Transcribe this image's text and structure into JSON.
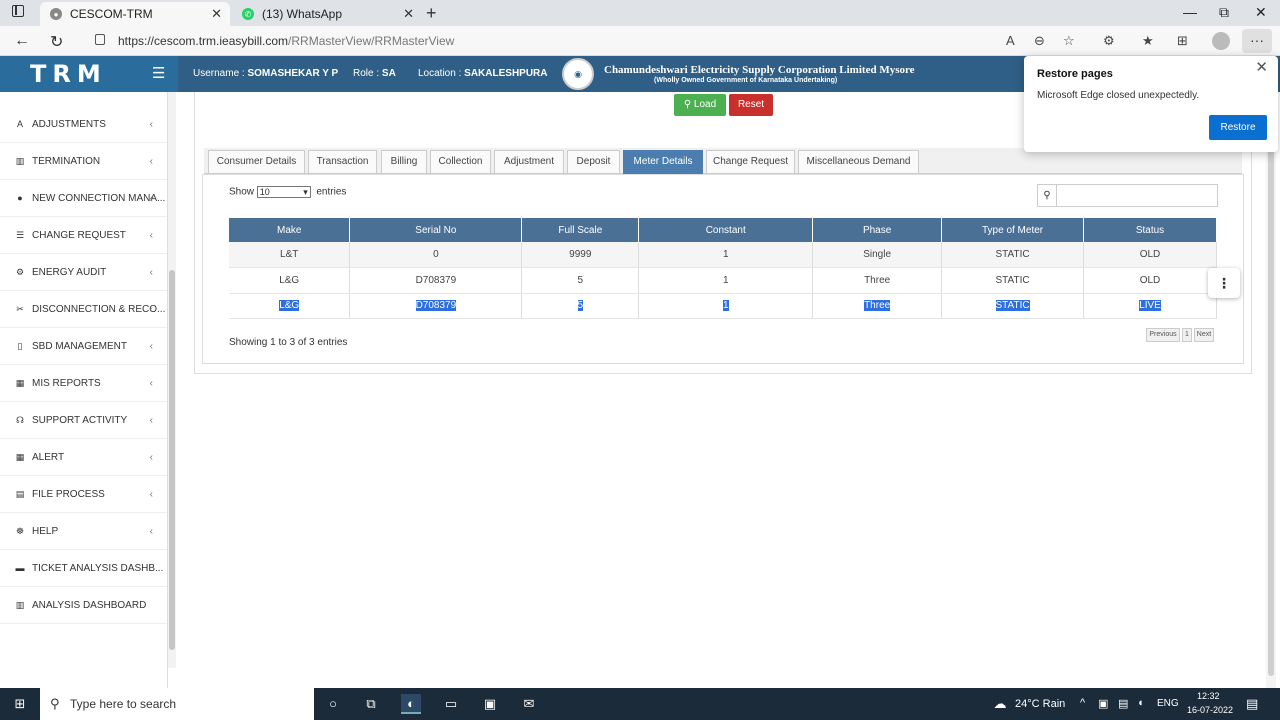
{
  "browser": {
    "tabs": [
      {
        "title": "CESCOM-TRM"
      },
      {
        "title": "(13) WhatsApp"
      }
    ],
    "url_host": "https://cescom.trm.ieasybill.com",
    "url_path": "/RRMasterView/RRMasterView"
  },
  "header": {
    "brand": "TRM",
    "username_label": "Username :",
    "username": "SOMASHEKAR Y P",
    "role_label": "Role :",
    "role": "SA",
    "location_label": "Location :",
    "location": "SAKALESHPURA",
    "corp_name": "Chamundeshwari Electricity Supply Corporation Limited Mysore",
    "corp_sub": "(Wholly Owned Government of Karnataka Undertaking)"
  },
  "sidebar": {
    "items": [
      {
        "label": "ADJUSTMENTS",
        "icon": "A",
        "chevron": true
      },
      {
        "label": "TERMINATION",
        "icon": "▥",
        "chevron": true
      },
      {
        "label": "NEW CONNECTION MANA...",
        "icon": "●",
        "chevron": true
      },
      {
        "label": "CHANGE REQUEST",
        "icon": "☰",
        "chevron": true
      },
      {
        "label": "ENERGY AUDIT",
        "icon": "⚙",
        "chevron": true
      },
      {
        "label": "DISCONNECTION & RECO...",
        "icon": "✂",
        "chevron": true
      },
      {
        "label": "SBD MANAGEMENT",
        "icon": "▯",
        "chevron": true
      },
      {
        "label": "MIS REPORTS",
        "icon": "▦",
        "chevron": true
      },
      {
        "label": "SUPPORT ACTIVITY",
        "icon": "☊",
        "chevron": true
      },
      {
        "label": "ALERT",
        "icon": "▦",
        "chevron": true
      },
      {
        "label": "FILE PROCESS",
        "icon": "▤",
        "chevron": true
      },
      {
        "label": "HELP",
        "icon": "☸",
        "chevron": true
      },
      {
        "label": "TICKET ANALYSIS DASHB...",
        "icon": "▬",
        "chevron": false
      },
      {
        "label": "ANALYSIS DASHBOARD",
        "icon": "▥",
        "chevron": false
      }
    ]
  },
  "actions": {
    "load": "Load",
    "reset": "Reset"
  },
  "tabs": [
    "Consumer Details",
    "Transaction",
    "Billing",
    "Collection",
    "Adjustment",
    "Deposit",
    "Meter Details",
    "Change Request",
    "Miscellaneous Demand"
  ],
  "active_tab": "Meter Details",
  "table_controls": {
    "show_label": "Show",
    "entries_value": "10",
    "entries_label": "entries",
    "search_value": ""
  },
  "table": {
    "columns": [
      "Make",
      "Serial No",
      "Full Scale",
      "Constant",
      "Phase",
      "Type of Meter",
      "Status"
    ],
    "rows": [
      [
        "L&T",
        "0",
        "9999",
        "1",
        "Single",
        "STATIC",
        "OLD"
      ],
      [
        "L&G",
        "D708379",
        "5",
        "1",
        "Three",
        "STATIC",
        "OLD"
      ],
      [
        "L&G",
        "D708379",
        "5",
        "1",
        "Three",
        "STATIC",
        "LIVE"
      ]
    ]
  },
  "table_info": "Showing 1 to 3 of 3 entries",
  "pagination": {
    "previous": "Previous",
    "page": "1",
    "next": "Next"
  },
  "restore_popup": {
    "title": "Restore pages",
    "message": "Microsoft Edge closed unexpectedly.",
    "button": "Restore"
  },
  "taskbar": {
    "search_placeholder": "Type here to search",
    "weather": "24°C  Rain",
    "language": "ENG",
    "time": "12:32",
    "date": "16-07-2022"
  }
}
